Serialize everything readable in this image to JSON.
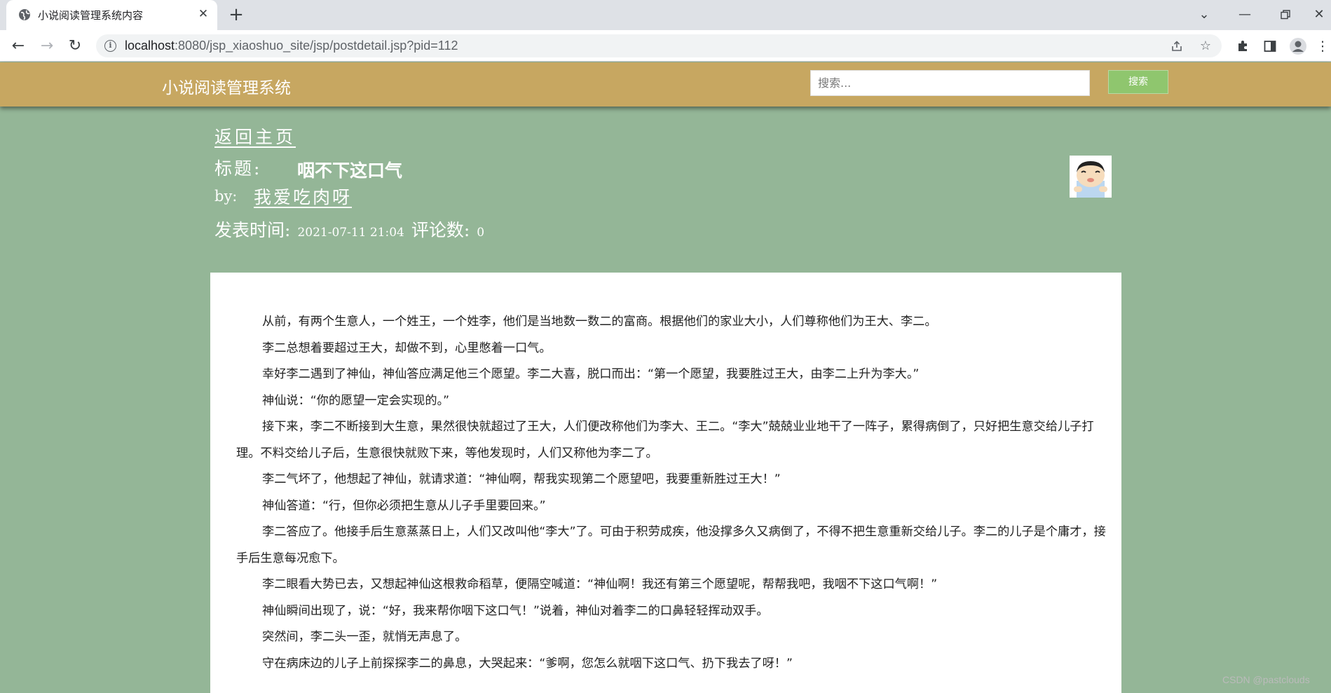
{
  "browser": {
    "tab_title": "小说阅读管理系统内容",
    "url_host": "localhost",
    "url_path": ":8080/jsp_xiaoshuo_site/jsp/postdetail.jsp?pid=112"
  },
  "site": {
    "brand": "小说阅读管理系统",
    "search_placeholder": "搜索...",
    "search_button": "搜索"
  },
  "post": {
    "back_home": "返回主页",
    "title_label": "标题:",
    "title": "咽不下这口气",
    "by_label": "by:",
    "author": "我爱吃肉呀",
    "time_label": "发表时间:",
    "time": "2021-07-11 21:04",
    "comment_label": "评论数:",
    "comment_count": "0"
  },
  "content": {
    "paragraphs": [
      "从前，有两个生意人，一个姓王，一个姓李，他们是当地数一数二的富商。根据他们的家业大小，人们尊称他们为王大、李二。",
      "李二总想着要超过王大，却做不到，心里憋着一口气。",
      "幸好李二遇到了神仙，神仙答应满足他三个愿望。李二大喜，脱口而出：“第一个愿望，我要胜过王大，由李二上升为李大。”",
      "神仙说：“你的愿望一定会实现的。”",
      "接下来，李二不断接到大生意，果然很快就超过了王大，人们便改称他们为李大、王二。“李大”兢兢业业地干了一阵子，累得病倒了，只好把生意交给儿子打理。不料交给儿子后，生意很快就败下来，等他发现时，人们又称他为李二了。",
      "李二气坏了，他想起了神仙，就请求道：“神仙啊，帮我实现第二个愿望吧，我要重新胜过王大！”",
      "神仙答道：“行，但你必须把生意从儿子手里要回来。”",
      "李二答应了。他接手后生意蒸蒸日上，人们又改叫他“李大”了。可由于积劳成疾，他没撑多久又病倒了，不得不把生意重新交给儿子。李二的儿子是个庸才，接手后生意每况愈下。",
      "李二眼看大势已去，又想起神仙这根救命稻草，便隔空喊道：“神仙啊！我还有第三个愿望呢，帮帮我吧，我咽不下这口气啊！”",
      "神仙瞬间出现了，说：“好，我来帮你咽下这口气！”说着，神仙对着李二的口鼻轻轻挥动双手。",
      "突然间，李二头一歪，就悄无声息了。",
      "守在病床边的儿子上前探探李二的鼻息，大哭起来：“爹啊，您怎么就咽下这口气、扔下我去了呀！”"
    ]
  },
  "watermark": "CSDN @pastclouds"
}
